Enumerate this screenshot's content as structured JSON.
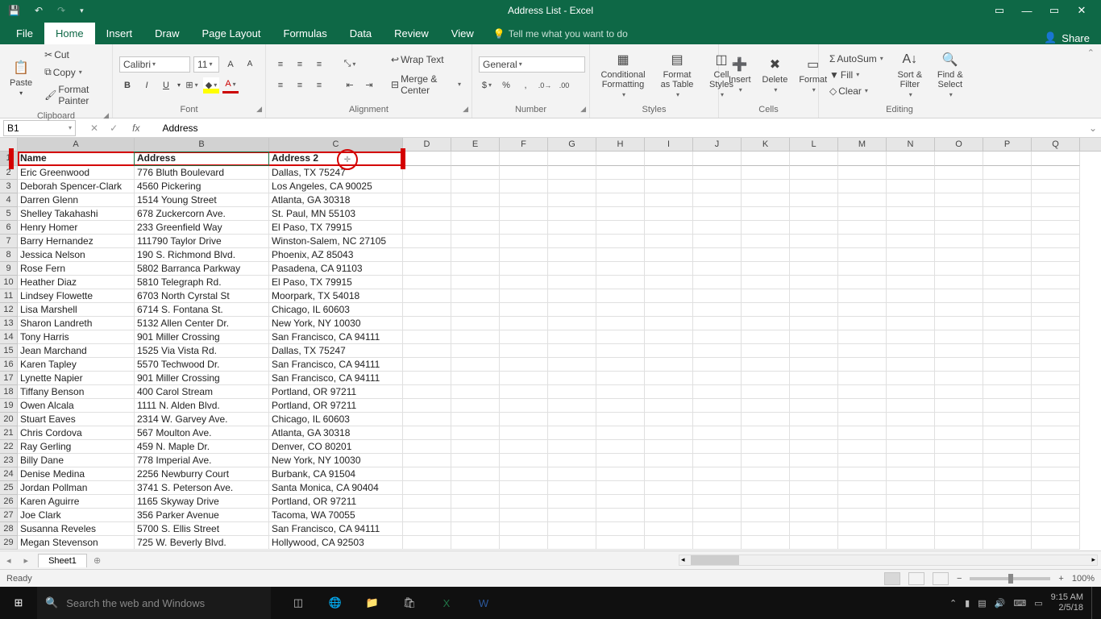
{
  "title": "Address List  -  Excel",
  "qat": {
    "save": "💾",
    "undo": "↶",
    "redo": "↷"
  },
  "win": {
    "ribbon_opts": "▭",
    "min": "—",
    "max": "▭",
    "close": "✕"
  },
  "tabs": [
    "File",
    "Home",
    "Insert",
    "Draw",
    "Page Layout",
    "Formulas",
    "Data",
    "Review",
    "View"
  ],
  "active_tab": "Home",
  "tellme": "Tell me what you want to do",
  "share": "Share",
  "ribbon": {
    "clipboard": {
      "paste": "Paste",
      "cut": "Cut",
      "copy": "Copy",
      "format_painter": "Format Painter",
      "label": "Clipboard"
    },
    "font": {
      "name": "Calibri",
      "size": "11",
      "label": "Font"
    },
    "alignment": {
      "wrap": "Wrap Text",
      "merge": "Merge & Center",
      "label": "Alignment"
    },
    "number": {
      "format": "General",
      "label": "Number"
    },
    "styles": {
      "cond": "Conditional Formatting",
      "fat": "Format as Table",
      "cell": "Cell Styles",
      "label": "Styles"
    },
    "cells": {
      "insert": "Insert",
      "delete": "Delete",
      "format": "Format",
      "label": "Cells"
    },
    "editing": {
      "autosum": "AutoSum",
      "fill": "Fill",
      "clear": "Clear",
      "sort": "Sort & Filter",
      "find": "Find & Select",
      "label": "Editing"
    }
  },
  "namebox": "B1",
  "formula": "Address",
  "columns": [
    "A",
    "B",
    "C",
    "D",
    "E",
    "F",
    "G",
    "H",
    "I",
    "J",
    "K",
    "L",
    "M",
    "N",
    "O",
    "P",
    "Q"
  ],
  "selected_cols": [
    "A",
    "B",
    "C"
  ],
  "data_rows": [
    [
      "Name",
      "Address",
      "Address 2"
    ],
    [
      "Eric Greenwood",
      "776 Bluth Boulevard",
      "Dallas, TX 75247"
    ],
    [
      "Deborah Spencer-Clark",
      "4560 Pickering",
      "Los Angeles, CA 90025"
    ],
    [
      "Darren Glenn",
      "1514 Young Street",
      "Atlanta, GA 30318"
    ],
    [
      "Shelley Takahashi",
      "678 Zuckercorn Ave.",
      "St. Paul, MN 55103"
    ],
    [
      "Henry Homer",
      "233 Greenfield Way",
      "El Paso, TX 79915"
    ],
    [
      "Barry Hernandez",
      "111790 Taylor Drive",
      "Winston-Salem, NC 27105"
    ],
    [
      "Jessica Nelson",
      "190 S. Richmond Blvd.",
      "Phoenix, AZ 85043"
    ],
    [
      "Rose Fern",
      "5802 Barranca Parkway",
      "Pasadena, CA 91103"
    ],
    [
      "Heather Diaz",
      "5810 Telegraph Rd.",
      "El Paso, TX 79915"
    ],
    [
      "Lindsey Flowette",
      "6703 North Cyrstal St",
      "Moorpark, TX 54018"
    ],
    [
      "Lisa Marshell",
      "6714 S. Fontana St.",
      "Chicago, IL 60603"
    ],
    [
      "Sharon Landreth",
      "5132 Allen Center Dr.",
      "New York, NY 10030"
    ],
    [
      "Tony Harris",
      "901 Miller Crossing",
      "San Francisco, CA 94111"
    ],
    [
      "Jean Marchand",
      "1525 Via Vista Rd.",
      "Dallas, TX 75247"
    ],
    [
      "Karen Tapley",
      "5570 Techwood Dr.",
      "San Francisco, CA 94111"
    ],
    [
      "Lynette Napier",
      "901 Miller Crossing",
      "San Francisco, CA 94111"
    ],
    [
      "Tiffany Benson",
      "400 Carol Stream",
      "Portland, OR 97211"
    ],
    [
      "Owen Alcala",
      "1111 N. Alden Blvd.",
      "Portland, OR 97211"
    ],
    [
      "Stuart Eaves",
      "2314 W. Garvey Ave.",
      "Chicago, IL 60603"
    ],
    [
      "Chris Cordova",
      "567 Moulton Ave.",
      "Atlanta, GA 30318"
    ],
    [
      "Ray Gerling",
      "459 N. Maple Dr.",
      "Denver, CO 80201"
    ],
    [
      "Billy Dane",
      "778 Imperial Ave.",
      "New York, NY 10030"
    ],
    [
      "Denise Medina",
      "2256 Newburry Court",
      "Burbank, CA 91504"
    ],
    [
      "Jordan Pollman",
      "3741 S. Peterson Ave.",
      "Santa Monica, CA 90404"
    ],
    [
      "Karen Aguirre",
      "1165 Skyway Drive",
      "Portland, OR 97211"
    ],
    [
      "Joe Clark",
      "356 Parker Avenue",
      "Tacoma, WA 70055"
    ],
    [
      "Susanna Reveles",
      "5700 S. Ellis Street",
      "San Francisco, CA 94111"
    ],
    [
      "Megan Stevenson",
      "725 W. Beverly Blvd.",
      "Hollywood, CA 92503"
    ]
  ],
  "sheet": "Sheet1",
  "status": "Ready",
  "zoom": "100%",
  "taskbar": {
    "search_placeholder": "Search the web and Windows",
    "time": "9:15 AM",
    "date": "2/5/18"
  }
}
